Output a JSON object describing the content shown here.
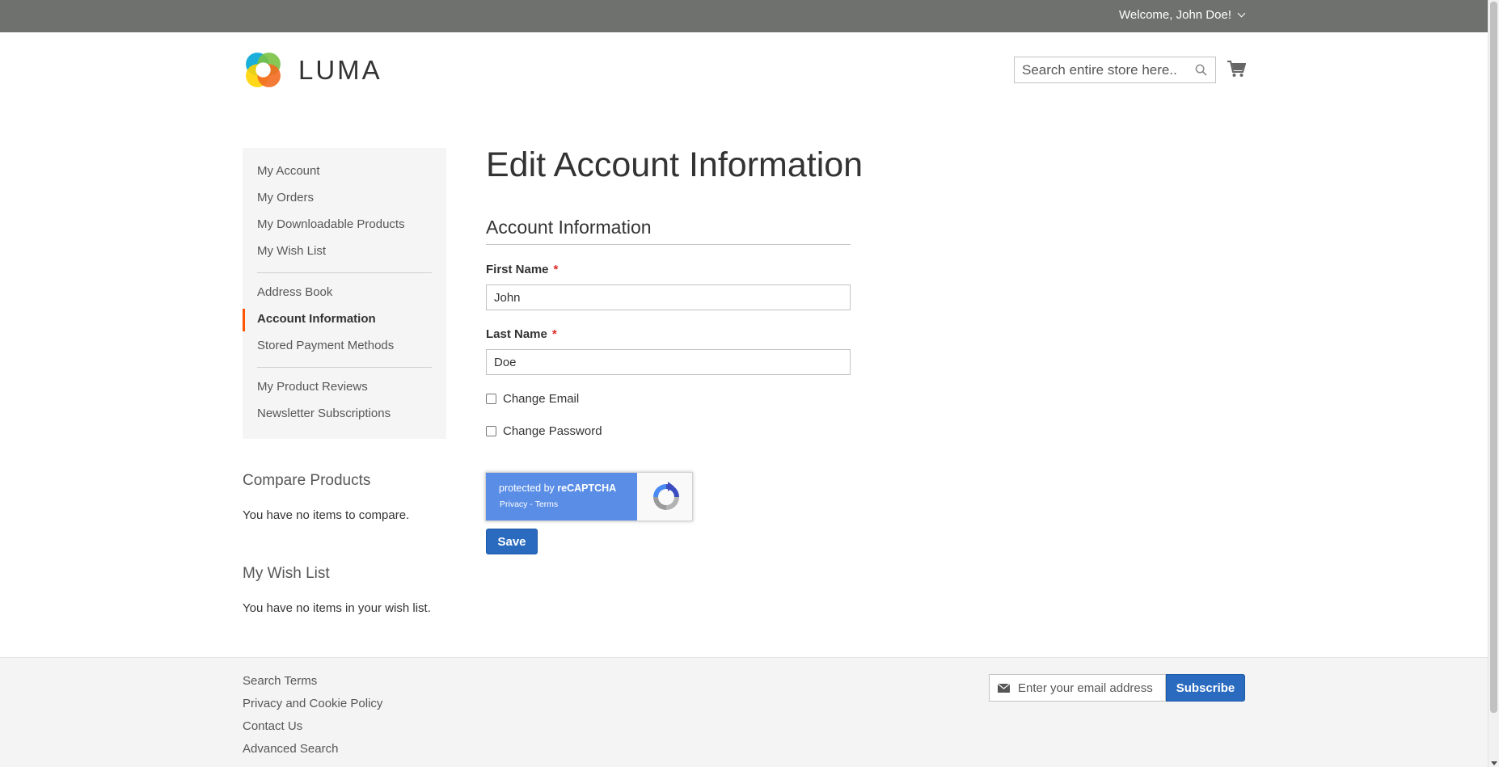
{
  "header": {
    "welcome_text": "Welcome, John Doe!",
    "logo_text": "LUMA",
    "search": {
      "placeholder": "Search entire store here..."
    }
  },
  "sidebar": {
    "items": [
      {
        "label": "My Account"
      },
      {
        "label": "My Orders"
      },
      {
        "label": "My Downloadable Products"
      },
      {
        "label": "My Wish List"
      },
      {
        "label": "Address Book"
      },
      {
        "label": "Account Information",
        "active": true
      },
      {
        "label": "Stored Payment Methods"
      },
      {
        "label": "My Product Reviews"
      },
      {
        "label": "Newsletter Subscriptions"
      }
    ]
  },
  "compare": {
    "title": "Compare Products",
    "text": "You have no items to compare."
  },
  "wishlist": {
    "title": "My Wish List",
    "text": "You have no items in your wish list."
  },
  "main": {
    "page_title": "Edit Account Information",
    "section_title": "Account Information",
    "first_name": {
      "label": "First Name",
      "value": "John",
      "required": "*"
    },
    "last_name": {
      "label": "Last Name",
      "value": "Doe",
      "required": "*"
    },
    "change_email": {
      "label": "Change Email",
      "checked": false
    },
    "change_password": {
      "label": "Change Password",
      "checked": false
    },
    "recaptcha": {
      "line1_prefix": "protected by ",
      "line1_brand": "reCAPTCHA",
      "line2": "Privacy - Terms"
    },
    "save_label": "Save"
  },
  "footer": {
    "links": [
      "Search Terms",
      "Privacy and Cookie Policy",
      "Contact Us",
      "Advanced Search"
    ],
    "newsletter_placeholder": "Enter your email address",
    "subscribe_label": "Subscribe"
  },
  "colors": {
    "topbar": "#6e716e",
    "primary_button": "#2a6bbf",
    "active_accent": "#ff5501",
    "required": "#e02b27"
  }
}
